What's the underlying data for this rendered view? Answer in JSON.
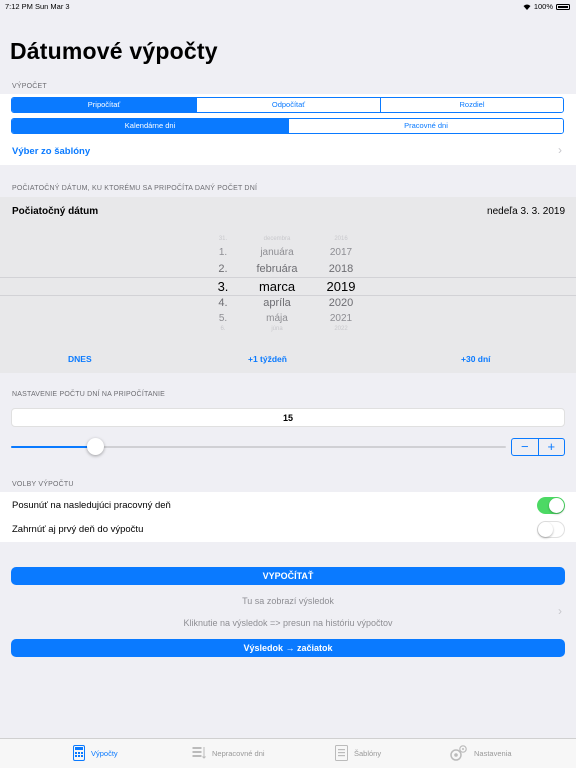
{
  "status": {
    "time": "7:12 PM",
    "date": "Sun Mar 3",
    "battery": "100%"
  },
  "page_title": "Dátumové výpočty",
  "calc": {
    "label": "VÝPOČET",
    "mode_tabs": [
      "Pripočítať",
      "Odpočítať",
      "Rozdiel"
    ],
    "day_tabs": [
      "Kalendárne dni",
      "Pracovné dni"
    ],
    "templates_link": "Výber zo šablóny"
  },
  "start": {
    "section_label": "POČIATOČNÝ DÁTUM, KU KTORÉMU SA PRIPOČÍTA DANÝ POČET DNÍ",
    "label": "Počiatočný dátum",
    "value": "nedeľa 3. 3. 2019",
    "picker": {
      "days": [
        "31.",
        "1.",
        "2.",
        "3.",
        "4.",
        "5.",
        "6."
      ],
      "months": [
        "decembra",
        "januára",
        "februára",
        "marca",
        "apríla",
        "mája",
        "júna"
      ],
      "years": [
        "2016",
        "2017",
        "2018",
        "2019",
        "2020",
        "2021",
        "2022"
      ]
    },
    "quick": [
      "DNES",
      "+1 týždeň",
      "+30 dní"
    ]
  },
  "days": {
    "section_label": "NASTAVENIE POČTU DNÍ NA PRIPOČÍTANIE",
    "value": "15",
    "slider_fraction": 0.17,
    "minus": "−",
    "plus": "+"
  },
  "options": {
    "section_label": "VOLBY VÝPOČTU",
    "items": [
      {
        "label": "Posunúť na nasledujúci pracovný deň",
        "on": true
      },
      {
        "label": "Zahrnúť aj prvý deň do výpočtu",
        "on": false
      }
    ]
  },
  "result": {
    "calc_button": "VYPOČÍTAŤ",
    "placeholder": "Tu sa zobrazí výsledok",
    "hint": "Kliknutie na výsledok => presun na históriu výpočtov",
    "to_start_button": "Výsledok → začiatok"
  },
  "tabs": [
    "Výpočty",
    "Nepracovné dni",
    "Šablóny",
    "Nastavenia"
  ],
  "colors": {
    "accent": "#0a7aff",
    "toggle_on": "#4cd964"
  }
}
